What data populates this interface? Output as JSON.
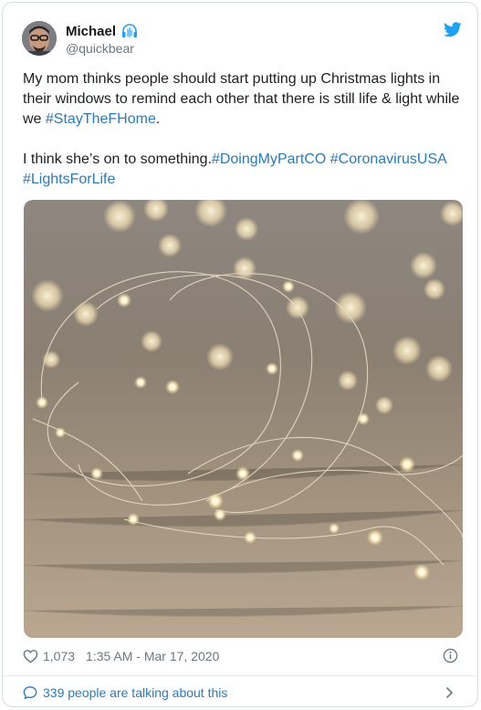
{
  "user": {
    "name": "Michael",
    "handle": "@quickbear"
  },
  "tweet": {
    "line1_text": "My mom thinks people should start putting up Christmas lights in their windows to remind each other that there is still life & light while we ",
    "line1_tag": "#StayTheFHome",
    "line1_end": ".",
    "line2_text": "I think she’s on to something.",
    "tags2": [
      "#DoingMyPartCO",
      "#CoronavirusUSA",
      "#LightsForLife"
    ]
  },
  "meta": {
    "likes": "1,073",
    "timestamp": "1:35 AM - Mar 17, 2020"
  },
  "footer": {
    "conversation": "339 people are talking about this"
  },
  "icons": {
    "verified_badge": "headphones-icon",
    "brand": "twitter-bird-icon",
    "like": "heart-icon",
    "info": "info-icon",
    "reply": "speech-bubble-icon",
    "more": "chevron-right-icon"
  },
  "colors": {
    "link": "#2b7bb9",
    "twitter_blue": "#1da1f2",
    "muted": "#697882"
  }
}
